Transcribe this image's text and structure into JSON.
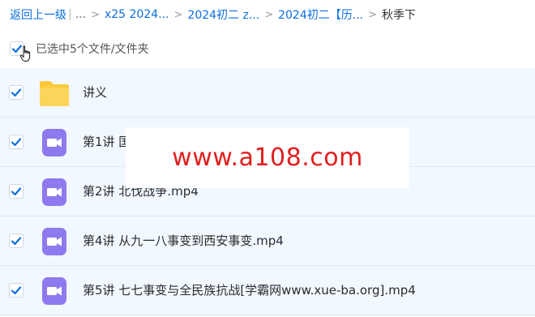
{
  "breadcrumb": {
    "back_label": "返回上一级",
    "ellipsis": "...",
    "items": [
      "x25 2024...",
      "2024初二 z...",
      "2024初二【历..."
    ],
    "current": "秋季下"
  },
  "selection": {
    "label": "已选中5个文件/文件夹",
    "checked": true
  },
  "files": [
    {
      "name": "讲义",
      "type": "folder",
      "icon": "folder-icon",
      "checked": true
    },
    {
      "name": "第1讲 国",
      "type": "video",
      "icon": "video-file-icon",
      "checked": true
    },
    {
      "name": "第2讲 北伐战争.mp4",
      "type": "video",
      "icon": "video-file-icon",
      "checked": true
    },
    {
      "name": "第4讲 从九一八事变到西安事变.mp4",
      "type": "video",
      "icon": "video-file-icon",
      "checked": true
    },
    {
      "name": "第5讲 七七事变与全民族抗战[学霸网www.xue-ba.org].mp4",
      "type": "video",
      "icon": "video-file-icon",
      "checked": true
    }
  ],
  "watermark": {
    "text": "www.a108.com"
  },
  "colors": {
    "link": "#0b6ee0",
    "row_bg": "#f1f8ff",
    "check": "#0b6ee0",
    "folder": "#fbc93b",
    "video_icon": "#8e79ee",
    "watermark": "#e21e1e"
  }
}
